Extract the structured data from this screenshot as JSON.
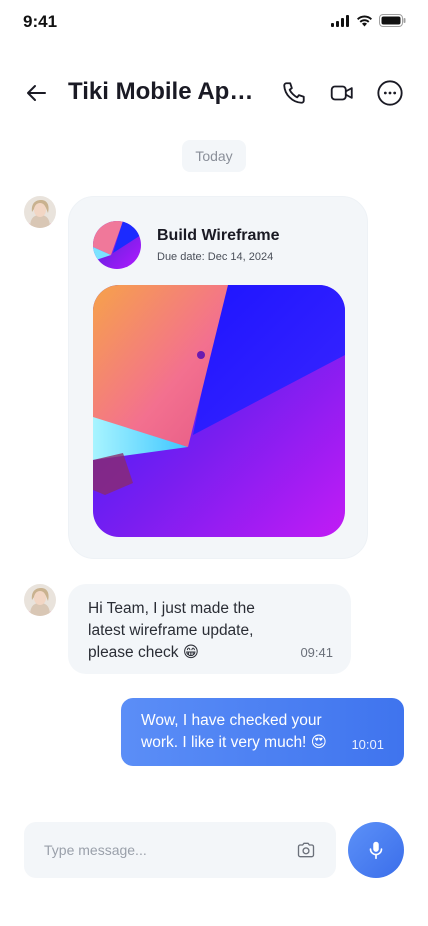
{
  "status_bar": {
    "time": "9:41",
    "icons": [
      "signal-icon",
      "wifi-icon",
      "battery-icon"
    ]
  },
  "header": {
    "back_icon": "back-arrow-icon",
    "title": "Tiki Mobile App Project",
    "actions": [
      "phone-icon",
      "video-call-icon",
      "more-icon"
    ]
  },
  "date_chip": "Today",
  "task_card": {
    "title": "Build Wireframe",
    "due": "Due date: Dec 14, 2024"
  },
  "messages": {
    "incoming": {
      "text": "Hi Team, I just made the latest wireframe update, please check 😁",
      "time": "09:41"
    },
    "outgoing": {
      "text": "Wow, I have checked your work. I like it very much! 😍",
      "time": "10:01"
    }
  },
  "composer": {
    "placeholder": "Type message...",
    "camera_icon": "camera-icon",
    "mic_icon": "microphone-icon"
  },
  "colors": {
    "accent": "#4a7ff2",
    "bubble": "#f3f6f9",
    "text": "#1a1a24"
  }
}
